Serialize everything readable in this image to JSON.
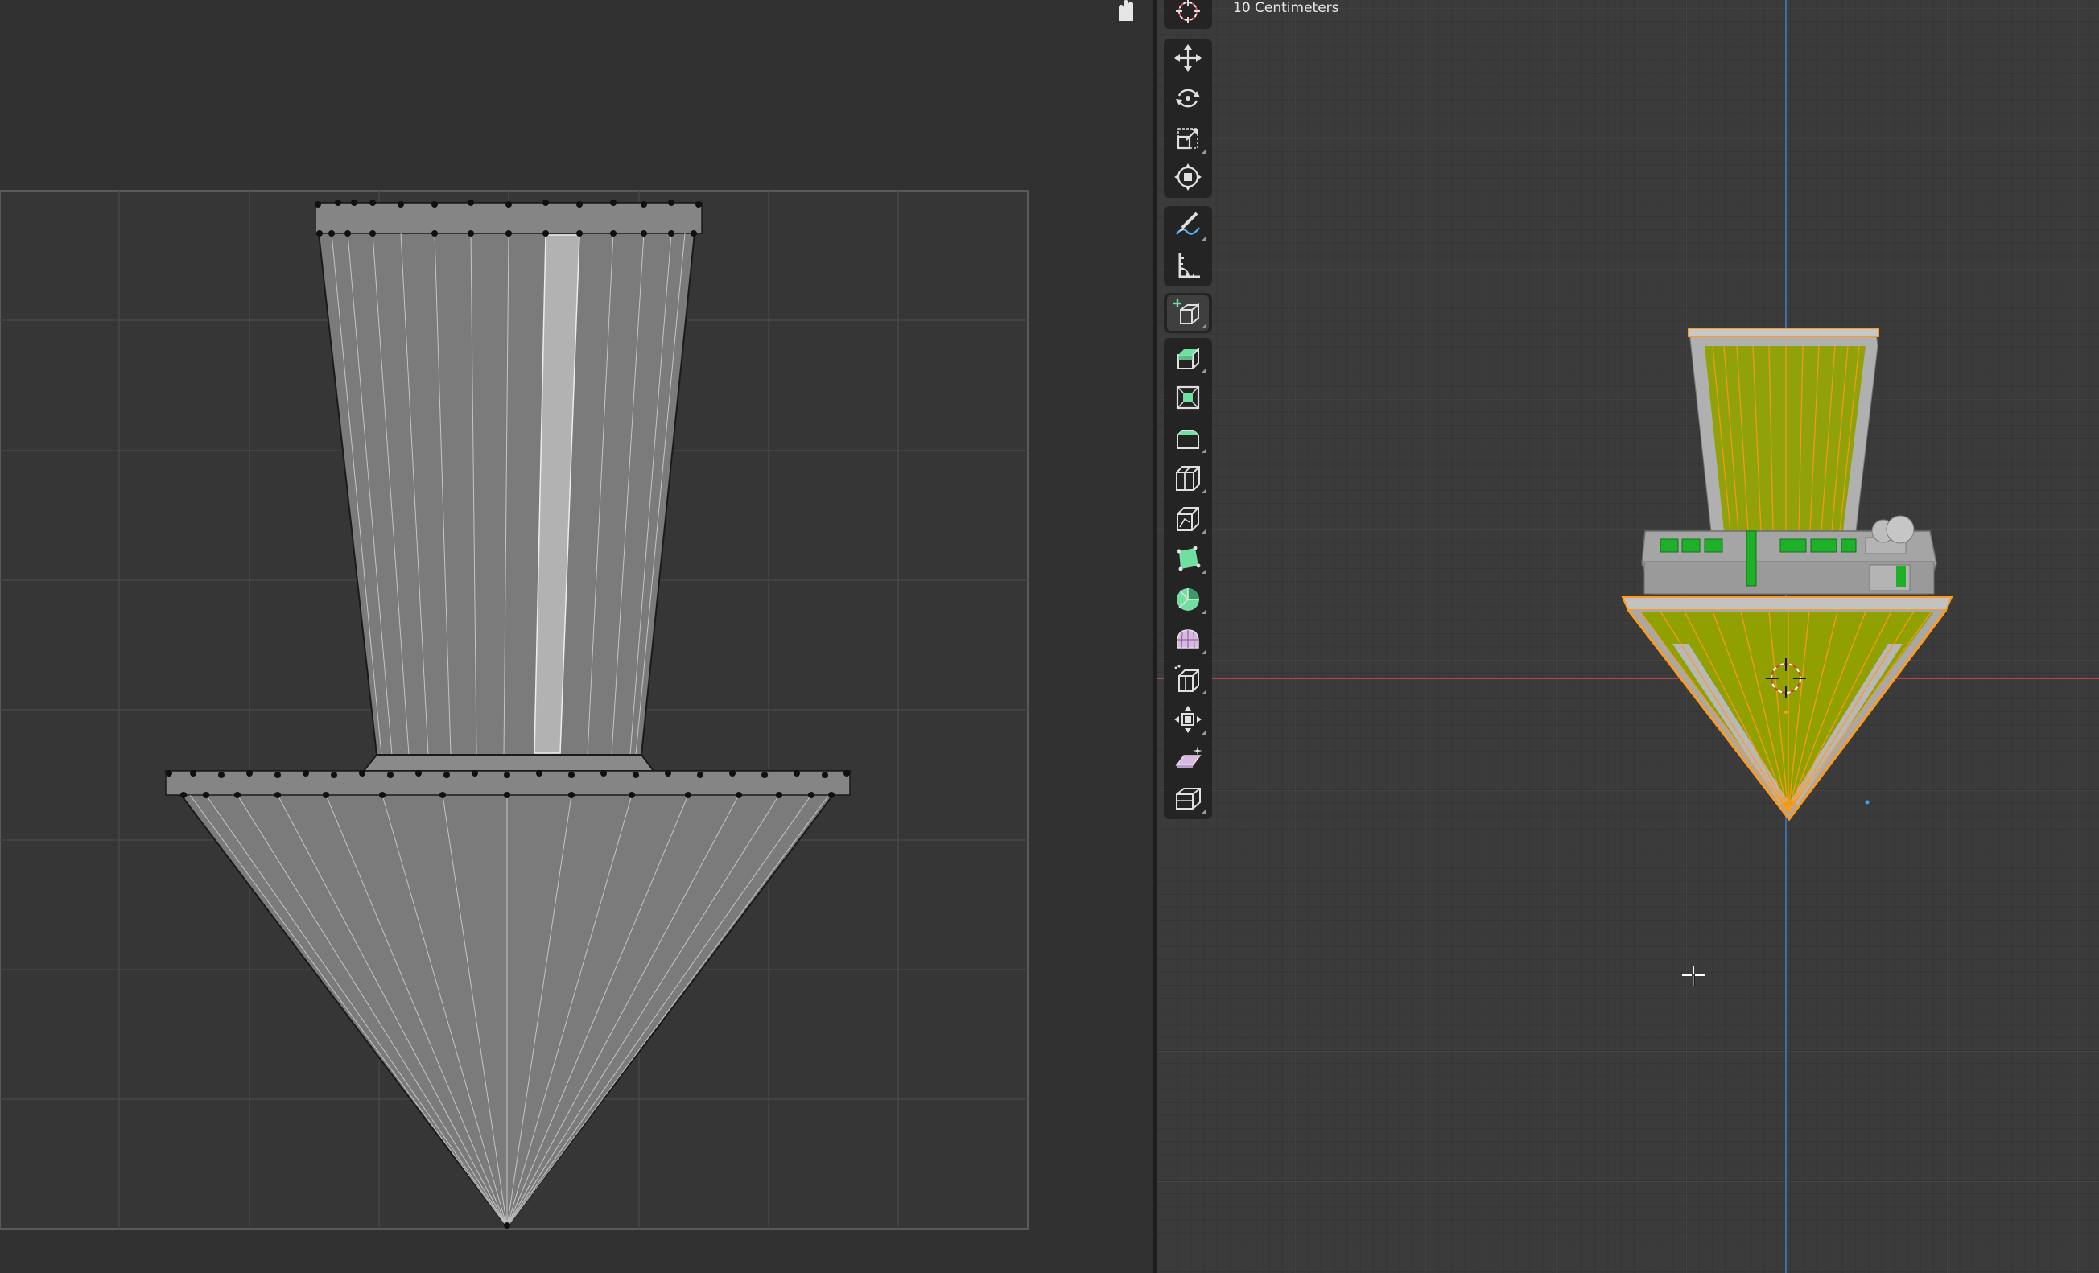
{
  "viewport": {
    "scale_label": "10 Centimeters"
  },
  "toolbar": {
    "groups": [
      [
        "cursor-tool"
      ],
      [
        "move-tool",
        "rotate-tool",
        "scale-tool",
        "transform-tool"
      ],
      [
        "annotate-tool",
        "measure-tool"
      ],
      [
        "add-cube-tool"
      ],
      [
        "extrude-region-tool",
        "inset-faces-tool",
        "bevel-tool",
        "loop-cut-tool",
        "knife-tool",
        "poly-build-tool",
        "spin-tool",
        "smooth-tool",
        "edge-slide-tool",
        "shrink-fatten-tool",
        "shear-tool",
        "rip-region-tool"
      ]
    ]
  },
  "colors": {
    "uv_background": "#313131",
    "viewport_background": "#3b3b3b",
    "toolbar_background": "#242424",
    "mesh_fill_yellow": "#8fa000",
    "mesh_edge_orange": "#ff9a1a",
    "mesh_green_window": "#1fb02a",
    "mesh_grey": "#a8a8a8",
    "axis_red": "#b0464b",
    "axis_blue": "#3c6fa8",
    "uv_face": "#7a7a7a"
  }
}
